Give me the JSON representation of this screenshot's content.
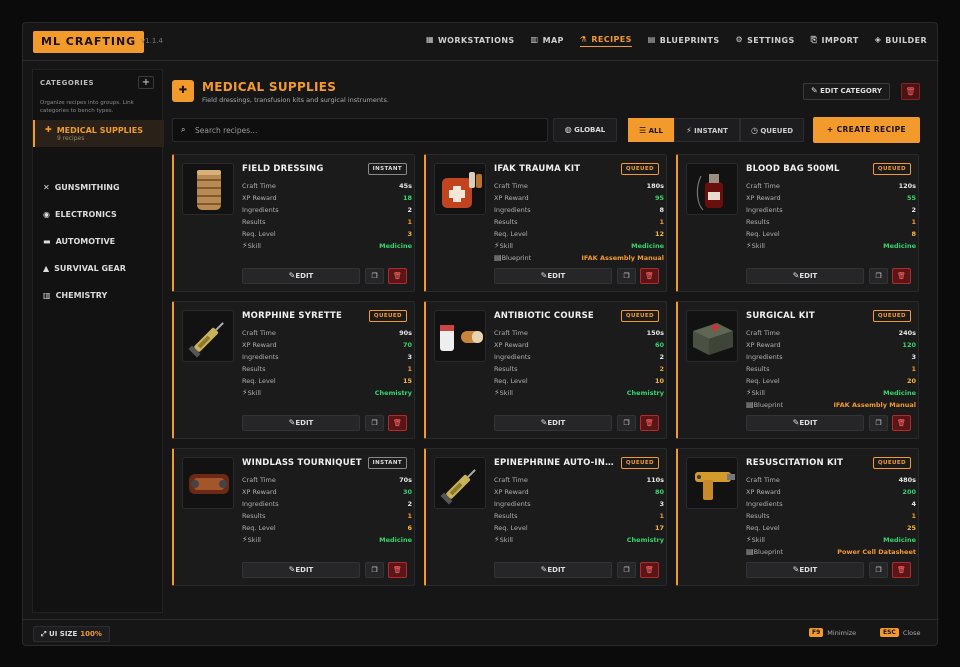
{
  "app": {
    "brand": "ML CRAFTING",
    "version": "v1.1.4"
  },
  "nav": [
    {
      "label": "WORKSTATIONS",
      "icon": "factory-icon",
      "glyph": "▦"
    },
    {
      "label": "MAP",
      "icon": "map-icon",
      "glyph": "▥"
    },
    {
      "label": "RECIPES",
      "icon": "flask-icon",
      "glyph": "⚗",
      "active": true
    },
    {
      "label": "BLUEPRINTS",
      "icon": "scroll-icon",
      "glyph": "▤"
    },
    {
      "label": "SETTINGS",
      "icon": "gear-icon",
      "glyph": "⚙"
    },
    {
      "label": "IMPORT",
      "icon": "file-import-icon",
      "glyph": "⎘"
    },
    {
      "label": "BUILDER",
      "icon": "cube-icon",
      "glyph": "◈"
    }
  ],
  "sidebar": {
    "heading": "CATEGORIES",
    "add_label": "+",
    "description": "Organize recipes into groups. Link categories to bench types.",
    "items": [
      {
        "label": "MEDICAL SUPPLIES",
        "count": "9 recipes",
        "glyph": "✚",
        "active": true
      },
      {
        "label": "GUNSMITHING",
        "glyph": "✕"
      },
      {
        "label": "ELECTRONICS",
        "glyph": "◉"
      },
      {
        "label": "AUTOMOTIVE",
        "glyph": "▬"
      },
      {
        "label": "SURVIVAL GEAR",
        "glyph": "▲"
      },
      {
        "label": "CHEMISTRY",
        "glyph": "▥"
      }
    ]
  },
  "header": {
    "title": "MEDICAL SUPPLIES",
    "subtitle": "Field dressings, transfusion kits and surgical instruments.",
    "edit_category": "EDIT CATEGORY"
  },
  "toolbar": {
    "search_placeholder": "Search recipes...",
    "global_label": "GLOBAL",
    "filters": [
      {
        "label": "ALL",
        "glyph": "☰",
        "active": true
      },
      {
        "label": "INSTANT",
        "glyph": "⚡"
      },
      {
        "label": "QUEUED",
        "glyph": "◷"
      }
    ],
    "create_label": "CREATE RECIPE"
  },
  "labels": {
    "craft_time": "Craft Time",
    "xp_reward": "XP Reward",
    "ingredients": "Ingredients",
    "results": "Results",
    "req_level": "Req. Level",
    "skill": "Skill",
    "blueprint": "Blueprint",
    "edit": "EDIT"
  },
  "recipes": [
    {
      "title": "FIELD DRESSING",
      "badge": "INSTANT",
      "craft_time": "45s",
      "xp": "18",
      "ingredients": "2",
      "results": "1",
      "level": "3",
      "skill": "Medicine",
      "thumb": "bandage"
    },
    {
      "title": "IFAK TRAUMA KIT",
      "badge": "QUEUED",
      "craft_time": "180s",
      "xp": "95",
      "ingredients": "8",
      "results": "1",
      "level": "12",
      "skill": "Medicine",
      "blueprint": "IFAK Assembly Manual",
      "thumb": "kit"
    },
    {
      "title": "BLOOD BAG 500ML",
      "badge": "QUEUED",
      "craft_time": "120s",
      "xp": "55",
      "ingredients": "2",
      "results": "1",
      "level": "8",
      "skill": "Medicine",
      "thumb": "bloodbag"
    },
    {
      "title": "MORPHINE SYRETTE",
      "badge": "QUEUED",
      "craft_time": "90s",
      "xp": "70",
      "ingredients": "3",
      "results": "1",
      "level": "15",
      "skill": "Chemistry",
      "thumb": "syringe"
    },
    {
      "title": "ANTIBIOTIC COURSE",
      "badge": "QUEUED",
      "craft_time": "150s",
      "xp": "60",
      "ingredients": "2",
      "results": "2",
      "level": "10",
      "skill": "Chemistry",
      "thumb": "pills"
    },
    {
      "title": "SURGICAL KIT",
      "badge": "QUEUED",
      "craft_time": "240s",
      "xp": "120",
      "ingredients": "3",
      "results": "1",
      "level": "20",
      "skill": "Medicine",
      "blueprint": "IFAK Assembly Manual",
      "thumb": "box"
    },
    {
      "title": "WINDLASS TOURNIQUET",
      "badge": "INSTANT",
      "craft_time": "70s",
      "xp": "30",
      "ingredients": "2",
      "results": "1",
      "level": "6",
      "skill": "Medicine",
      "thumb": "tourniquet"
    },
    {
      "title": "EPINEPHRINE AUTO-INJECTOR",
      "badge": "QUEUED",
      "craft_time": "110s",
      "xp": "80",
      "ingredients": "3",
      "results": "1",
      "level": "17",
      "skill": "Chemistry",
      "thumb": "syringe"
    },
    {
      "title": "RESUSCITATION KIT",
      "badge": "QUEUED",
      "craft_time": "480s",
      "xp": "200",
      "ingredients": "4",
      "results": "1",
      "level": "25",
      "skill": "Medicine",
      "blueprint": "Power Cell Datasheet",
      "thumb": "gun"
    }
  ],
  "footer": {
    "ui_size_label": "UI SIZE",
    "ui_size_value": "100%",
    "minimize_key": "F9",
    "minimize_label": "Minimize",
    "close_key": "ESC",
    "close_label": "Close"
  },
  "colors": {
    "accent": "#f39a2c",
    "green": "#35d46b",
    "danger": "#b22a2a"
  }
}
